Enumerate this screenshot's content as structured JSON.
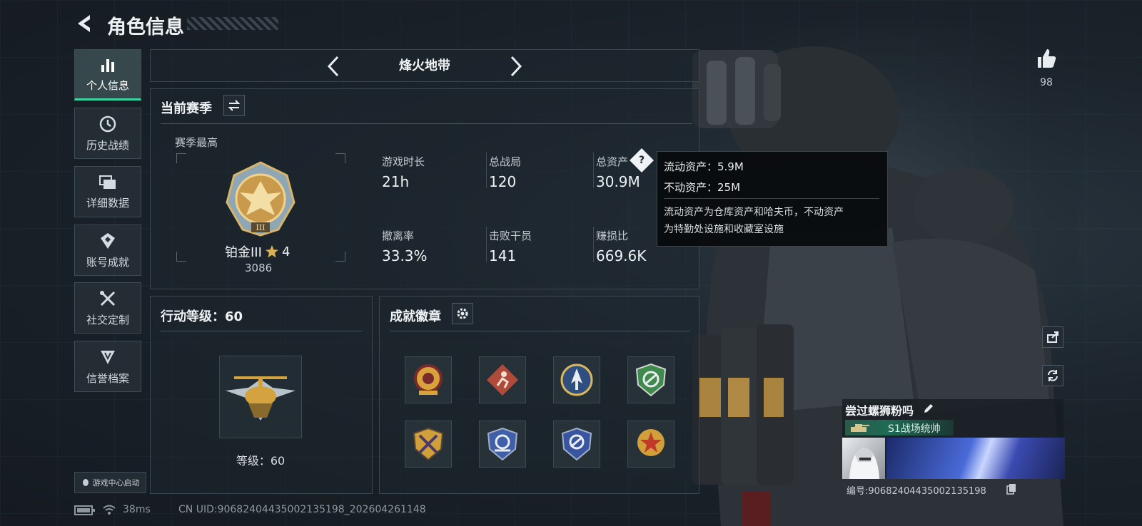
{
  "header": {
    "title": "角色信息"
  },
  "mode_selector": {
    "current": "烽火地带"
  },
  "sidebar": {
    "items": [
      {
        "label": "个人信息",
        "icon": "bar-chart-icon",
        "active": true
      },
      {
        "label": "历史战绩",
        "icon": "history-icon",
        "active": false
      },
      {
        "label": "详细数据",
        "icon": "folders-icon",
        "active": false
      },
      {
        "label": "账号成就",
        "icon": "achievement-icon",
        "active": false
      },
      {
        "label": "社交定制",
        "icon": "tools-icon",
        "active": false
      },
      {
        "label": "信誉档案",
        "icon": "credit-icon",
        "active": false
      }
    ],
    "launch_label": "游戏中心启动"
  },
  "season": {
    "title": "当前赛季",
    "best_label": "赛季最高",
    "rank_name": "铂金III",
    "rank_stars": "4",
    "rank_score": "3086",
    "stats": [
      {
        "label": "游戏时长",
        "value": "21h"
      },
      {
        "label": "总战局",
        "value": "120"
      },
      {
        "label": "总资产",
        "value": "30.9M"
      },
      {
        "label": "撤离率",
        "value": "33.3%"
      },
      {
        "label": "击败干员",
        "value": "141"
      },
      {
        "label": "赚损比",
        "value": "669.6K"
      }
    ]
  },
  "tooltip": {
    "liquid": "流动资产：5.9M",
    "fixed": "不动资产：25M",
    "desc_line1": "流动资产为仓库资产和哈夫币，不动资产",
    "desc_line2": "为特勤处设施和收藏室设施"
  },
  "action_level": {
    "title": "行动等级：60",
    "level_text": "等级：60"
  },
  "achievements": {
    "title": "成就徽章",
    "badges": [
      {
        "icon": "gold-emblem-icon",
        "color": "#d9a23a"
      },
      {
        "icon": "red-runner-icon",
        "color": "#b04a3a"
      },
      {
        "icon": "blue-arrow-icon",
        "color": "#4a86c8"
      },
      {
        "icon": "green-shield-icon",
        "color": "#3f8a4c"
      },
      {
        "icon": "gold-crossed-shield-icon",
        "color": "#d2a03a"
      },
      {
        "icon": "blue-wings-shield-icon",
        "color": "#3f5fa8"
      },
      {
        "icon": "blue-wings-shield-icon-2",
        "color": "#3a55a0"
      },
      {
        "icon": "red-star-medal-icon",
        "color": "#c0392b"
      }
    ]
  },
  "likes": {
    "count": "98"
  },
  "player": {
    "name": "尝过螺狮粉吗",
    "title_badge": "S1战场统帅",
    "id_text": "编号:906824044350021351​98"
  },
  "status_bar": {
    "ping": "38ms",
    "uid": "CN UID:906824044350021351​98_202604261148"
  },
  "colors": {
    "accent": "#37d6a0",
    "title_badge_bg": "#1f6b55"
  }
}
